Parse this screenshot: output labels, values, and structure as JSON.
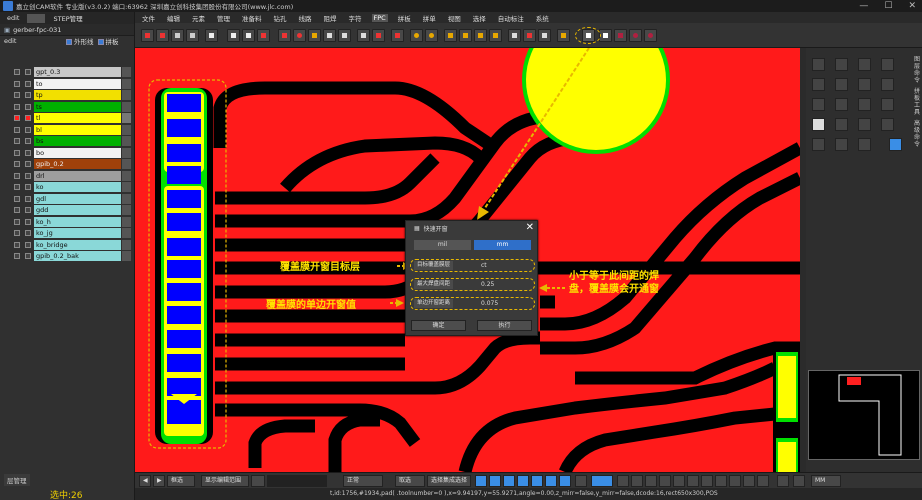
{
  "window": {
    "title": "嘉立创CAM软件 专业版(v3.0.2) 端口:63962    深圳嘉立创科技集团股份有限公司(www.jlc.com)",
    "min_glyph": "—",
    "max_glyph": "☐",
    "close_glyph": "✕"
  },
  "left_panel": {
    "tab_edit": "edit",
    "tab_step": "STEP管理",
    "job_name": "gerber-fpc-031",
    "step_name": "edit",
    "opt_outline": "外形线",
    "opt_panel": "拼板",
    "layers": [
      {
        "name": "gpt_0.3",
        "color": "#c8c8c8"
      },
      {
        "name": "to",
        "color": "#f2f2f2"
      },
      {
        "name": "tp",
        "color": "#f2e000"
      },
      {
        "name": "ts",
        "color": "#00b000"
      },
      {
        "name": "tl",
        "color": "#ffff00"
      },
      {
        "name": "bl",
        "color": "#ffff00"
      },
      {
        "name": "bs",
        "color": "#00b000"
      },
      {
        "name": "bo",
        "color": "#f2f2f2"
      },
      {
        "name": "gpib_0.2",
        "color": "#a0410a"
      },
      {
        "name": "drl",
        "color": "#9e9e9e"
      },
      {
        "name": "ko",
        "color": "#8ad8d8"
      },
      {
        "name": "gdl",
        "color": "#8ad8d8"
      },
      {
        "name": "gdd",
        "color": "#8ad8d8"
      },
      {
        "name": "ko_h",
        "color": "#8ad8d8"
      },
      {
        "name": "ko_jg",
        "color": "#8ad8d8"
      },
      {
        "name": "ko_bridge",
        "color": "#8ad8d8"
      },
      {
        "name": "gpib_0.2_bak",
        "color": "#8ad8d8"
      }
    ],
    "layer_manager": "层管理",
    "selected_count": "选中:26"
  },
  "menu": {
    "items": [
      "文件",
      "编辑",
      "元素",
      "管理",
      "准备料",
      "钻孔",
      "线路",
      "阻焊",
      "字符",
      "FPC",
      "拼板",
      "拼单",
      "视图",
      "选择",
      "自动标注",
      "系统"
    ],
    "active": "FPC"
  },
  "right_panel": {
    "side_tabs": [
      "图层命令",
      "拼板工具",
      "高级命令"
    ]
  },
  "dialog": {
    "title": "快速开窗",
    "unit_mil": "mil",
    "unit_mm": "mm",
    "target_label": "目标覆盖膜层",
    "target_value": "ct",
    "max_pad_label": "最大焊盘间距",
    "max_pad_value": "0.25",
    "single_label": "单边开窗距离",
    "single_value": "0.075",
    "ok": "确定",
    "exec": "执行"
  },
  "annotations": {
    "target_layer": "覆盖膜开窗目标层",
    "single_side": "覆盖膜的单边开窗值",
    "rule_line1": "小于等于此间距的焊",
    "rule_line2": "盘，覆盖膜会开通窗"
  },
  "bottom": {
    "mode": "框选",
    "show_region": "显示编辑范围",
    "line_type": "正常",
    "pick": "取选",
    "select_group": "选择集成选择",
    "unit": "MM",
    "status": "t,id:1756,#1934,pad( .toolnumber=0 ),x=9.94197,y=55.9271,angle=0.00,z_mirr=false,y_mirr=false,dcode:16,rect650x300,POS"
  },
  "colors": {
    "board_red": "#ff1a1a",
    "pad_blue": "#0000ff",
    "solder_green": "#00e000",
    "silk_yellow": "#ffff00",
    "annotation_yellow": "#ffe300",
    "accent_blue": "#2f6fc9"
  }
}
